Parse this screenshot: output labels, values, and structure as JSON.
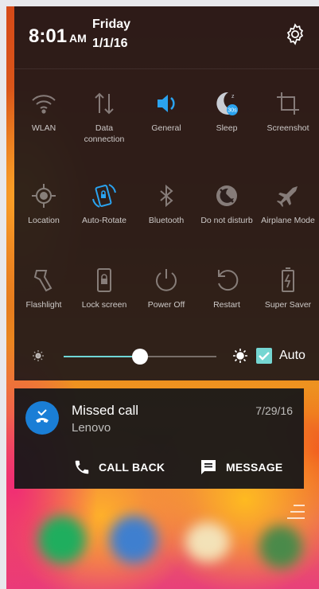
{
  "status": {
    "time": "8:01",
    "ampm": "AM",
    "day": "Friday",
    "date": "1/1/16"
  },
  "toggles": [
    {
      "label": "WLAN",
      "icon": "wifi-icon",
      "active": false
    },
    {
      "label": "Data\nconnection",
      "icon": "data-icon",
      "active": false
    },
    {
      "label": "General",
      "icon": "volume-icon",
      "active": true
    },
    {
      "label": "Sleep",
      "icon": "sleep-icon",
      "active": true,
      "badge": "30s"
    },
    {
      "label": "Screenshot",
      "icon": "crop-icon",
      "active": false
    },
    {
      "label": "Location",
      "icon": "location-icon",
      "active": false
    },
    {
      "label": "Auto-Rotate",
      "icon": "rotate-icon",
      "active": true
    },
    {
      "label": "Bluetooth",
      "icon": "bluetooth-icon",
      "active": false
    },
    {
      "label": "Do not disturb",
      "icon": "dnd-icon",
      "active": false
    },
    {
      "label": "Airplane Mode",
      "icon": "airplane-icon",
      "active": false
    },
    {
      "label": "Flashlight",
      "icon": "flashlight-icon",
      "active": false
    },
    {
      "label": "Lock screen",
      "icon": "lock-icon",
      "active": false
    },
    {
      "label": "Power Off",
      "icon": "power-icon",
      "active": false
    },
    {
      "label": "Restart",
      "icon": "restart-icon",
      "active": false
    },
    {
      "label": "Super Saver",
      "icon": "battery-icon",
      "active": false
    }
  ],
  "brightness": {
    "level": 0.5,
    "auto_label": "Auto",
    "auto_checked": true
  },
  "notification": {
    "title": "Missed call",
    "subtitle": "Lenovo",
    "date": "7/29/16",
    "action_call": "CALL BACK",
    "action_message": "MESSAGE"
  },
  "colors": {
    "accent": "#75d6d2",
    "notif_icon": "#1a7ed6",
    "active_icon": "#2aa3f0"
  }
}
